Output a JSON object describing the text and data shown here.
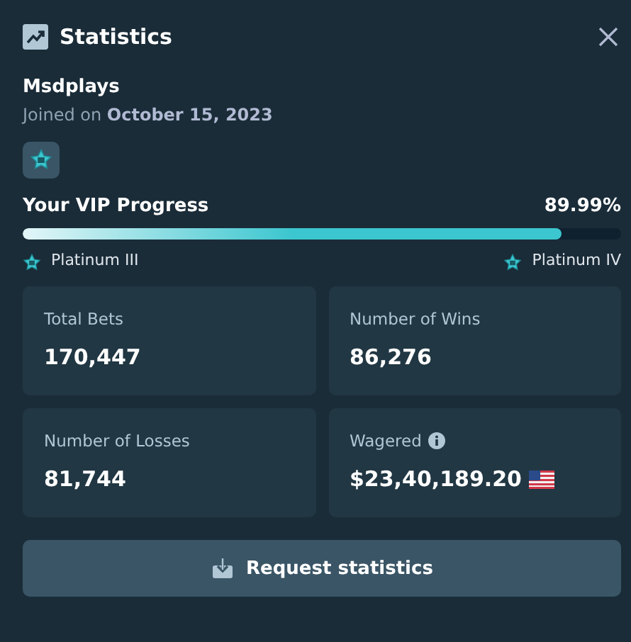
{
  "window": {
    "title": "Statistics"
  },
  "user": {
    "name": "Msdplays",
    "joined": "Joined on **October 15, 2023**"
  },
  "vip": {
    "label": "Your VIP Progress",
    "reading": "89.99%",
    "level": 0.8999,
    "current_tier": "Platinum III",
    "next_tier": "Platinum IV"
  },
  "stats": [
    {
      "label": "Total Bets",
      "value": "170,447",
      "info": false,
      "flag": false
    },
    {
      "label": "Number of Wins",
      "value": "86,276",
      "info": false,
      "flag": false
    },
    {
      "label": "Number of Losses",
      "value": "81,744",
      "info": false,
      "flag": false
    },
    {
      "label": "Wagered",
      "value": "$23,40,189.20",
      "info": true,
      "flag": true
    }
  ],
  "button": {
    "label": "Request statistics"
  }
}
